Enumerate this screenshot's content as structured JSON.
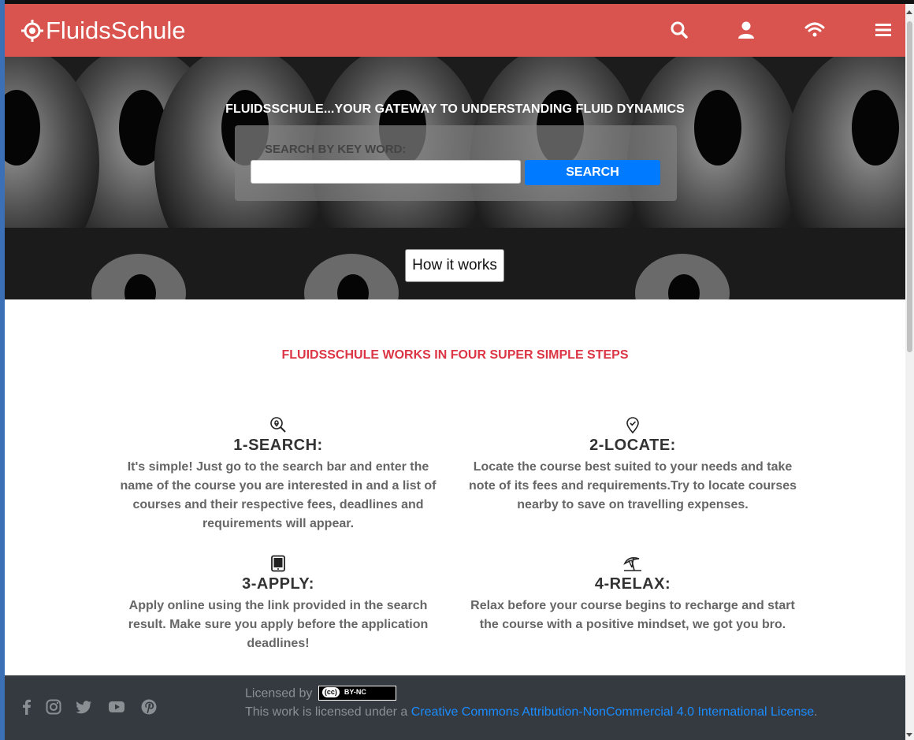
{
  "brand": {
    "name": "FluidsSchule",
    "logo_icon": "crosshair-icon"
  },
  "nav": {
    "icons": [
      "search-icon",
      "user-icon",
      "wifi-icon",
      "menu-icon"
    ]
  },
  "hero": {
    "title": "FLUIDSSCHULE...YOUR GATEWAY TO UNDERSTANDING FLUID DYNAMICS",
    "search_label": "SEARCH BY KEY WORD:",
    "search_placeholder": "",
    "search_value": "",
    "search_button": "SEARCH",
    "how_button": "How it works"
  },
  "steps": {
    "heading": "FLUIDSSCHULE WORKS IN FOUR SUPER SIMPLE STEPS",
    "items": [
      {
        "icon": "search-location-icon",
        "title": "1-SEARCH:",
        "text": "It's simple! Just go to the search bar and enter the name of the course you are interested in and a list of courses and their respective fees, deadlines and requirements will appear."
      },
      {
        "icon": "map-pin-check-icon",
        "title": "2-LOCATE:",
        "text": "Locate the course best suited to your needs and take note of its fees and requirements.Try to locate courses nearby to save on travelling expenses."
      },
      {
        "icon": "tablet-icon",
        "title": "3-APPLY:",
        "text": "Apply online using the link provided in the search result. Make sure you apply before the application deadlines!"
      },
      {
        "icon": "beach-umbrella-icon",
        "title": "4-RELAX:",
        "text": "Relax before your course begins to recharge and start the course with a positive mindset, we got you bro."
      }
    ]
  },
  "footer": {
    "social": [
      "facebook-icon",
      "instagram-icon",
      "twitter-icon",
      "youtube-icon",
      "pinterest-icon"
    ],
    "licensed_by": "Licensed by",
    "badge_cc": "(cc)",
    "badge_text": "BY-NC",
    "license_prefix": "This work is licensed under a ",
    "license_link": "Creative Commons Attribution-NonCommercial 4.0 International License",
    "license_suffix": "."
  },
  "colors": {
    "nav": "#d9534f",
    "accent": "#007bff",
    "heading_red": "#dc3545",
    "footer": "#343a40"
  }
}
